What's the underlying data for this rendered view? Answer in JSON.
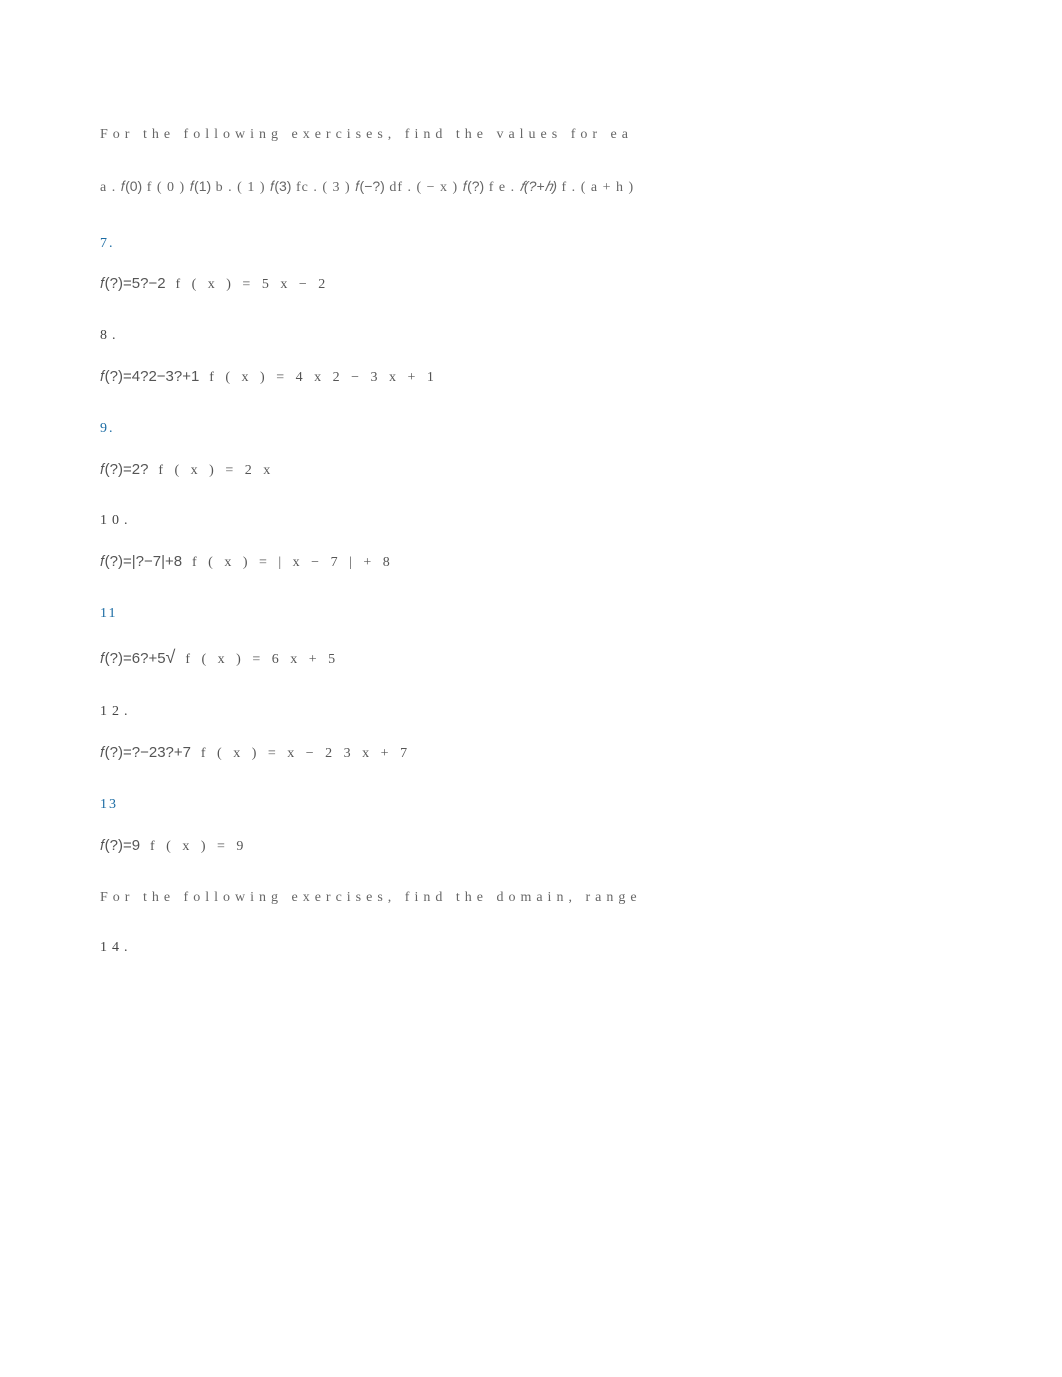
{
  "intro": "For the following exercises, find the values for ea",
  "parts": {
    "a": "a .",
    "a_expr": "𝑓(0)",
    "a_plain": "f ( 0 )",
    "b_expr": "𝑓(1)",
    "b": "b .",
    "b_plain": "( 1 )",
    "c_expr": "𝑓(3)",
    "c": "fc .",
    "c_plain": "( 3 )",
    "d_expr": "𝑓(−?)",
    "d": "df .",
    "d_plain": "( − x )",
    "e_expr": "𝑓(?)",
    "e": "f e .",
    "e_plain": "",
    "f_expr": "𝑓(?+ℎ)",
    "f": "f .",
    "f_plain": "( a + h )"
  },
  "ex7": {
    "num": "7.",
    "compact": "𝑓(?)=5?−2",
    "plain": "f ( x ) = 5 x − 2"
  },
  "ex8": {
    "num": "8.",
    "compact": "𝑓(?)=4?2−3?+1",
    "plain": "f ( x ) = 4 x 2 − 3 x + 1"
  },
  "ex9": {
    "num": "9.",
    "compact": "𝑓(?)=2?",
    "plain": "f ( x ) = 2 x"
  },
  "ex10": {
    "num": "10.",
    "compact": "𝑓(?)=|?−7|+8",
    "plain": "f ( x ) = | x − 7 | + 8"
  },
  "ex11": {
    "num": "11",
    "compact_pre": "𝑓(?)=6?+5",
    "overline": "          ",
    "sqrt": "√",
    "plain": "f ( x ) = 6 x + 5"
  },
  "ex12": {
    "num": "12.",
    "compact": "𝑓(?)=?−23?+7",
    "plain": "f ( x ) = x − 2 3 x + 7"
  },
  "ex13": {
    "num": "13",
    "compact": "𝑓(?)=9",
    "plain": "f ( x ) = 9"
  },
  "intro2": "For the following exercises, find the domain, range",
  "ex14": {
    "num": "14."
  }
}
